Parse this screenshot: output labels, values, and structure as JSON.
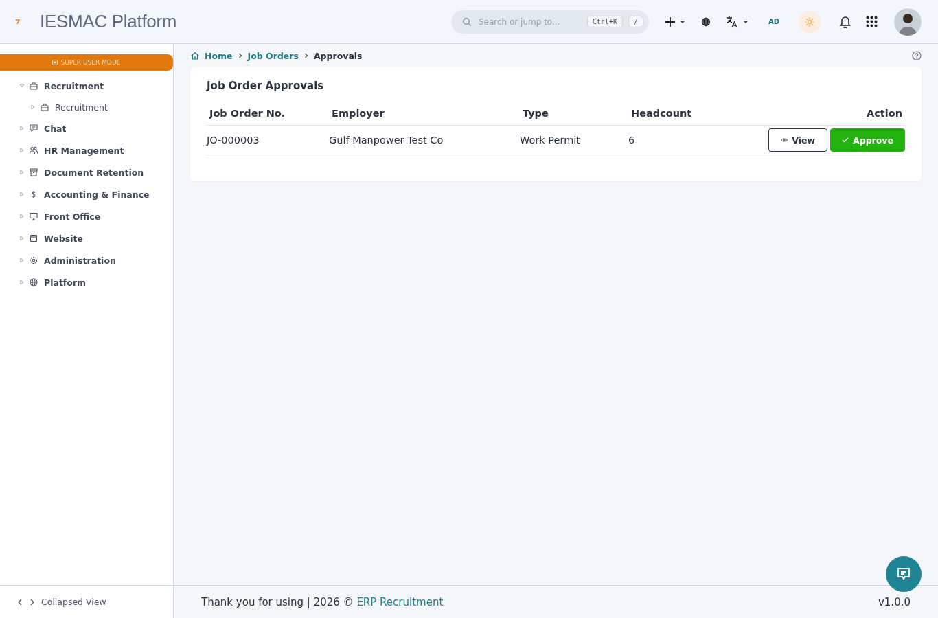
{
  "header": {
    "title": "IESMAC Platform",
    "search": {
      "placeholder": "Search or jump to...",
      "shortcut": "Ctrl+K",
      "slash": "/"
    },
    "user_initials": "AD"
  },
  "sidebar": {
    "mode_banner": "SUPER USER MODE",
    "items": [
      {
        "label": "Recruitment",
        "expanded": true,
        "children": [
          {
            "label": "Recruitment",
            "expanded": false
          }
        ]
      },
      {
        "label": "Chat",
        "expanded": false
      },
      {
        "label": "HR Management",
        "expanded": false
      },
      {
        "label": "Document Retention",
        "expanded": false
      },
      {
        "label": "Accounting & Finance",
        "expanded": false
      },
      {
        "label": "Front Office",
        "expanded": false
      },
      {
        "label": "Website",
        "expanded": false
      },
      {
        "label": "Administration",
        "expanded": false
      },
      {
        "label": "Platform",
        "expanded": false
      }
    ],
    "footer": "Collapsed View"
  },
  "breadcrumb": [
    "Home",
    "Job Orders",
    "Approvals"
  ],
  "card": {
    "title": "Job Order Approvals",
    "columns": [
      "Job Order No.",
      "Employer",
      "Type",
      "Headcount",
      "Action"
    ],
    "rows": [
      {
        "cells": [
          "JO-000003",
          "Gulf Manpower Test Co",
          "Work Permit",
          "6"
        ],
        "actions": [
          "View",
          "Approve"
        ]
      }
    ]
  },
  "footer": {
    "text": "Thank you for using | 2026 © ",
    "link": "ERP Recruitment",
    "version": "v1.0.0"
  }
}
